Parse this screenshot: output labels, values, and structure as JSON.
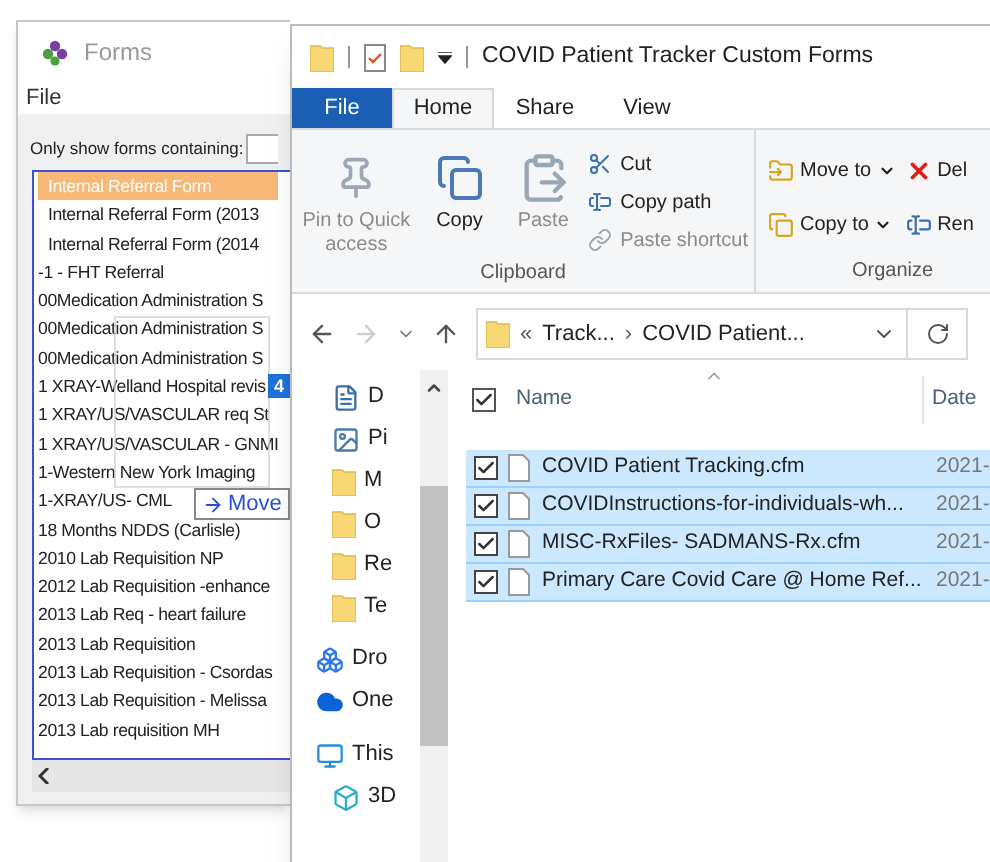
{
  "forms_window": {
    "title": "Forms",
    "menu": [
      "File"
    ],
    "filter_label": "Only show forms containing:",
    "items": [
      {
        "label": "Internal Referral Form",
        "selected": true
      },
      {
        "label": "Internal Referral Form (2013",
        "selected": false
      },
      {
        "label": "Internal Referral Form (2014",
        "selected": false
      },
      {
        "label": "-1 - FHT Referral",
        "selected": false
      },
      {
        "label": "00Medication Administration S",
        "selected": false
      },
      {
        "label": "00Medication Administration S",
        "selected": false
      },
      {
        "label": "00Medication Administration S",
        "selected": false
      },
      {
        "label": "1 XRAY-Welland Hospital revis",
        "selected": false
      },
      {
        "label": "1 XRAY/US/VASCULAR  req St",
        "selected": false
      },
      {
        "label": "1 XRAY/US/VASCULAR - GNMI",
        "selected": false
      },
      {
        "label": "1-Western New York Imaging",
        "selected": false
      },
      {
        "label": "1-XRAY/US- CML",
        "selected": false
      },
      {
        "label": "18 Months NDDS (Carlisle)",
        "selected": false
      },
      {
        "label": "2010 Lab Requisition NP",
        "selected": false
      },
      {
        "label": "2012 Lab Requisition -enhance",
        "selected": false
      },
      {
        "label": "2013 Lab Req - heart failure",
        "selected": false
      },
      {
        "label": "2013 Lab Requisition",
        "selected": false
      },
      {
        "label": "2013 Lab Requisition - Csordas",
        "selected": false
      },
      {
        "label": "2013 Lab Requisition - Melissa",
        "selected": false
      },
      {
        "label": "2013 Lab requisition MH",
        "selected": false
      }
    ],
    "drag": {
      "count": "4",
      "action": "Move"
    }
  },
  "explorer": {
    "title": "COVID Patient Tracker Custom Forms",
    "tabs": [
      {
        "label": "File",
        "kind": "file",
        "selected": false
      },
      {
        "label": "Home",
        "kind": "tab",
        "selected": true
      },
      {
        "label": "Share",
        "kind": "tab",
        "selected": false
      },
      {
        "label": "View",
        "kind": "tab",
        "selected": false
      }
    ],
    "clipboard": {
      "label": "Clipboard",
      "large": [
        {
          "label": "Pin to Quick access",
          "kind": "pin",
          "disabled": true
        },
        {
          "label": "Copy",
          "kind": "copy",
          "disabled": false
        },
        {
          "label": "Paste",
          "kind": "paste",
          "disabled": true
        }
      ],
      "small": [
        {
          "label": "Cut",
          "kind": "cut",
          "disabled": false
        },
        {
          "label": "Copy path",
          "kind": "path",
          "disabled": false
        },
        {
          "label": "Paste shortcut",
          "kind": "shortcut",
          "disabled": true
        }
      ]
    },
    "organize": {
      "label": "Organize",
      "items": [
        {
          "label": "Move to",
          "kind": "move"
        },
        {
          "label": "Copy to",
          "kind": "copyto"
        },
        {
          "label": "Del",
          "kind": "delete"
        },
        {
          "label": "Ren",
          "kind": "rename"
        }
      ]
    },
    "address": {
      "prefix": "«",
      "crumbs": [
        "Track...",
        "COVID Patient..."
      ],
      "separator": "›"
    },
    "nav_pane": [
      {
        "label": "D",
        "kind": "doc"
      },
      {
        "label": "Pi",
        "kind": "pictures"
      },
      {
        "label": "M",
        "kind": "folder"
      },
      {
        "label": "O",
        "kind": "folder"
      },
      {
        "label": "Re",
        "kind": "folder"
      },
      {
        "label": "Te",
        "kind": "folder"
      },
      {
        "label": "Dro",
        "kind": "dropbox"
      },
      {
        "label": "One",
        "kind": "onedrive"
      },
      {
        "label": "This",
        "kind": "pc"
      },
      {
        "label": "3D",
        "kind": "objects"
      }
    ],
    "columns": [
      "Name",
      "Date"
    ],
    "all_checked": true,
    "files": [
      {
        "name": "COVID Patient Tracking.cfm",
        "date": "2021-",
        "selected": true,
        "checked": true
      },
      {
        "name": "COVIDInstructions-for-individuals-wh...",
        "date": "2021-",
        "selected": true,
        "checked": true
      },
      {
        "name": "MISC-RxFiles- SADMANS-Rx.cfm",
        "date": "2021-",
        "selected": true,
        "checked": true
      },
      {
        "name": "Primary Care Covid Care @ Home Ref...",
        "date": "2021-",
        "selected": true,
        "checked": true
      }
    ]
  }
}
